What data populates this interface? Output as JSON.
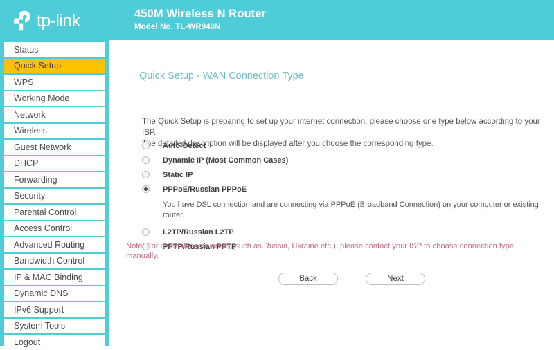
{
  "header": {
    "logo_icon": "tp-link-logo-icon",
    "logo_text": "tp-link",
    "title": "450M Wireless N Router",
    "subtitle": "Model No. TL-WR940N",
    "background_color": "#4ecdd8"
  },
  "sidebar": {
    "active_index": 1,
    "active_color": "#fcc200",
    "items": [
      {
        "label": "Status"
      },
      {
        "label": "Quick Setup"
      },
      {
        "label": "WPS"
      },
      {
        "label": "Working Mode"
      },
      {
        "label": "Network"
      },
      {
        "label": "Wireless"
      },
      {
        "label": "Guest Network"
      },
      {
        "label": "DHCP"
      },
      {
        "label": "Forwarding"
      },
      {
        "label": "Security"
      },
      {
        "label": "Parental Control"
      },
      {
        "label": "Access Control"
      },
      {
        "label": "Advanced Routing"
      },
      {
        "label": "Bandwidth Control"
      },
      {
        "label": "IP & MAC Binding"
      },
      {
        "label": "Dynamic DNS"
      },
      {
        "label": "IPv6 Support"
      },
      {
        "label": "System Tools"
      },
      {
        "label": "Logout"
      }
    ]
  },
  "main": {
    "page_title": "Quick Setup - WAN Connection Type",
    "title_color": "#6fbfc6",
    "intro_line1": "The Quick Setup is preparing to set up your internet connection, please choose one type below according to your ISP.",
    "intro_line2": "The detailed description will be displayed after you choose the corresponding type.",
    "options": [
      {
        "label": "Auto-Detect",
        "selected": false
      },
      {
        "label": "Dynamic IP (Most Common Cases)",
        "selected": false
      },
      {
        "label": "Static IP",
        "selected": false
      },
      {
        "label": "PPPoE/Russian PPPoE",
        "selected": true
      },
      {
        "label": "L2TP/Russian L2TP",
        "selected": false
      },
      {
        "label": "PPTP/Russian PPTP",
        "selected": false
      }
    ],
    "selected_description": "You have DSL connection and are connecting via PPPoE (Broadband Connection) on your computer or existing router.",
    "note": "Note: For users in some areas (such as Russia, Ukraine etc.), please contact your ISP to choose connection type manually.",
    "note_color": "#c86b86",
    "back_label": "Back",
    "next_label": "Next"
  }
}
